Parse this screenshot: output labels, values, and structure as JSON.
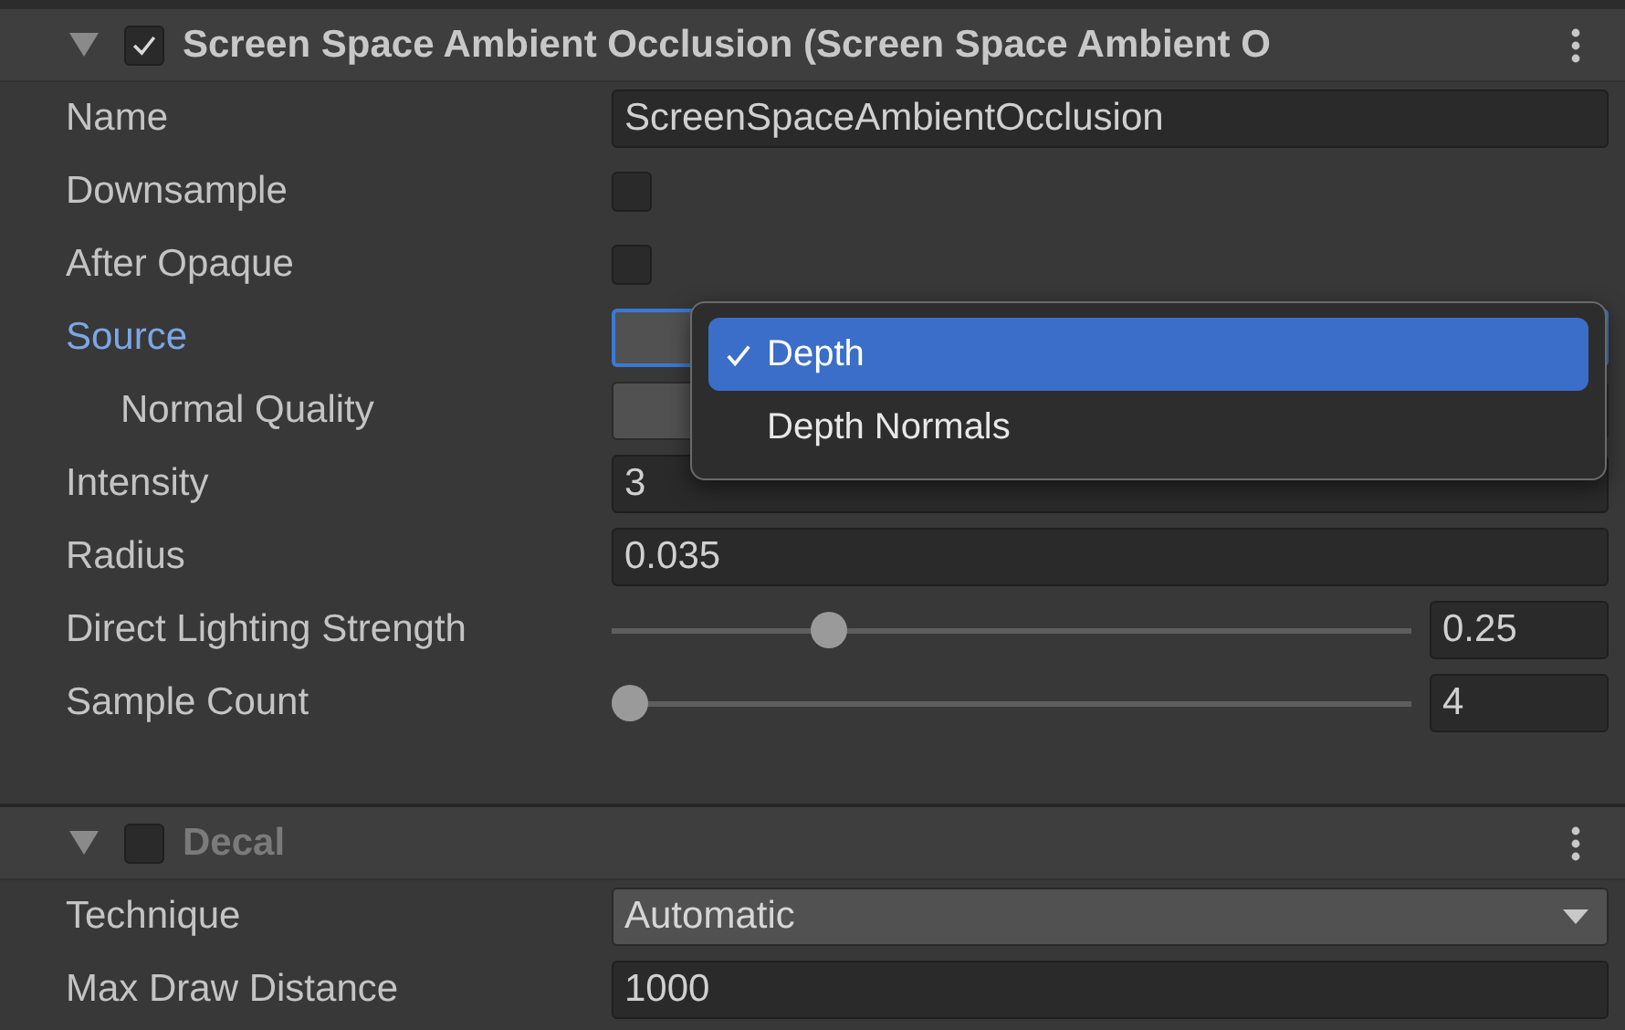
{
  "sections": [
    {
      "title": "Screen Space Ambient Occlusion (Screen Space Ambient O",
      "expanded": true,
      "enabled": true,
      "fields": [
        {
          "kind": "text",
          "label": "Name",
          "value": "ScreenSpaceAmbientOcclusion"
        },
        {
          "kind": "checkbox",
          "label": "Downsample",
          "checked": false
        },
        {
          "kind": "checkbox",
          "label": "After Opaque",
          "checked": false
        },
        {
          "kind": "dropdown",
          "label": "Source",
          "highlighted": true,
          "children": [
            {
              "kind": "dropdown",
              "label": "Normal Quality",
              "highlighted": false
            }
          ]
        },
        {
          "kind": "text",
          "label": "Intensity",
          "value": "3"
        },
        {
          "kind": "text",
          "label": "Radius",
          "value": "0.035"
        },
        {
          "kind": "slider",
          "label": "Direct Lighting Strength",
          "level": 0.26,
          "value": "0.25"
        },
        {
          "kind": "slider",
          "label": "Sample Count",
          "level": 0.0,
          "value": "4"
        }
      ]
    },
    {
      "title": "Decal",
      "expanded": true,
      "enabled": false,
      "fields": [
        {
          "kind": "dropdown",
          "label": "Technique",
          "value": "Automatic",
          "highlighted": false
        },
        {
          "kind": "text",
          "label": "Max Draw Distance",
          "value": "1000"
        }
      ]
    }
  ],
  "popup": {
    "options": [
      {
        "label": "Depth",
        "selected": true
      },
      {
        "label": "Depth Normals",
        "selected": false
      }
    ]
  }
}
